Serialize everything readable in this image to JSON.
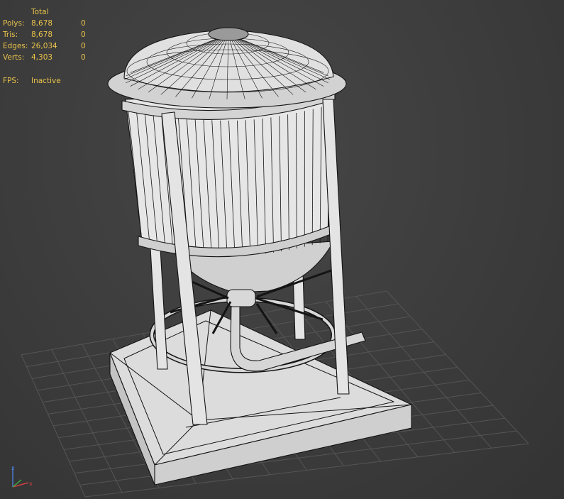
{
  "stats": {
    "header": "Total",
    "rows": [
      {
        "label": "Polys:",
        "total": "8,678",
        "selected": "0"
      },
      {
        "label": "Tris:",
        "total": "8,678",
        "selected": "0"
      },
      {
        "label": "Edges:",
        "total": "26,034",
        "selected": "0"
      },
      {
        "label": "Verts:",
        "total": "4,303",
        "selected": "0"
      }
    ],
    "fps_label": "FPS:",
    "fps_value": "Inactive"
  },
  "axis": {
    "z": "z",
    "x": "x"
  },
  "colors": {
    "stats_text": "#e8c24a",
    "background": "#3b3b3b",
    "grid": "#555555",
    "model_fill": "#e4e4e4",
    "wire": "#141414",
    "axis_z": "#4a7bd0",
    "axis_x": "#d04040"
  }
}
